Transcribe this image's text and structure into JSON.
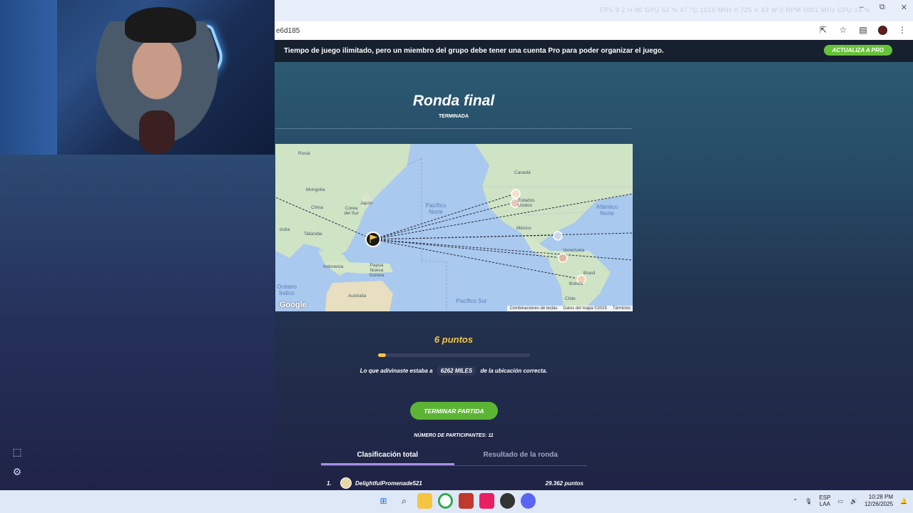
{
  "browser": {
    "url_fragment": "e6d185",
    "stats_overlay": "FPS 9   2 H MI   GPU 52 % 47 °C 1016 MHz 0.725 V 43 W 0 RPM 5001 MHz   CPU 14 %",
    "window_controls": [
      "–",
      "⧉",
      "✕"
    ]
  },
  "banner": {
    "message": "Tiempo de juego ilimitado, pero un miembro del grupo debe tener una cuenta Pro para poder organizar el juego.",
    "pro_button": "ACTUALIZA A PRO"
  },
  "round": {
    "title": "Ronda final",
    "status": "TERMINADA"
  },
  "map": {
    "labels": {
      "russia": "Rusia",
      "mongolia": "Mongolia",
      "china": "China",
      "korea": "Corea del Sur",
      "japan": "Japón",
      "india": "India",
      "thailand": "Tailandia",
      "indonesia": "Indonesia",
      "png": "Papúa Nueva Guinea",
      "australia": "Australia",
      "canada": "Canadá",
      "usa": "Estados Unidos",
      "mexico": "México",
      "venezuela": "Venezuela",
      "brazil": "Brasil",
      "bolivia": "Bolivia",
      "chile": "Chile",
      "north_pacific": "Pacífico Norte",
      "south_pacific": "Pacífico Sur",
      "north_atlantic": "Atlántico Norte",
      "indian_ocean": "Océano Índico"
    },
    "google": "Google",
    "footer": [
      "Combinaciones de teclas",
      "Datos del mapa ©2025",
      "Términos"
    ]
  },
  "result": {
    "points": "6 puntos",
    "progress_fraction": 0.05,
    "distance_prefix": "Lo que adivinaste estaba a",
    "distance_value": "6262 MILES",
    "distance_suffix": "de la ubicación correcta."
  },
  "end_button": "TERMINAR PARTIDA",
  "participants": "NÚMERO DE PARTICIPANTES: 11",
  "tabs": [
    {
      "label": "Clasificación total",
      "active": true
    },
    {
      "label": "Resultado de la ronda",
      "active": false
    }
  ],
  "leaderboard": [
    {
      "rank": "1.",
      "name": "DelightfulPromenade521",
      "score": "29.362 puntos"
    }
  ],
  "taskbar": {
    "lang_top": "ESP",
    "lang_bottom": "LAA",
    "time": "10:28 PM",
    "date": "12/26/2025"
  },
  "colors": {
    "accent_yellow": "#f5c542",
    "green_button": "#5cb435",
    "tab_active": "#a88ee8"
  }
}
